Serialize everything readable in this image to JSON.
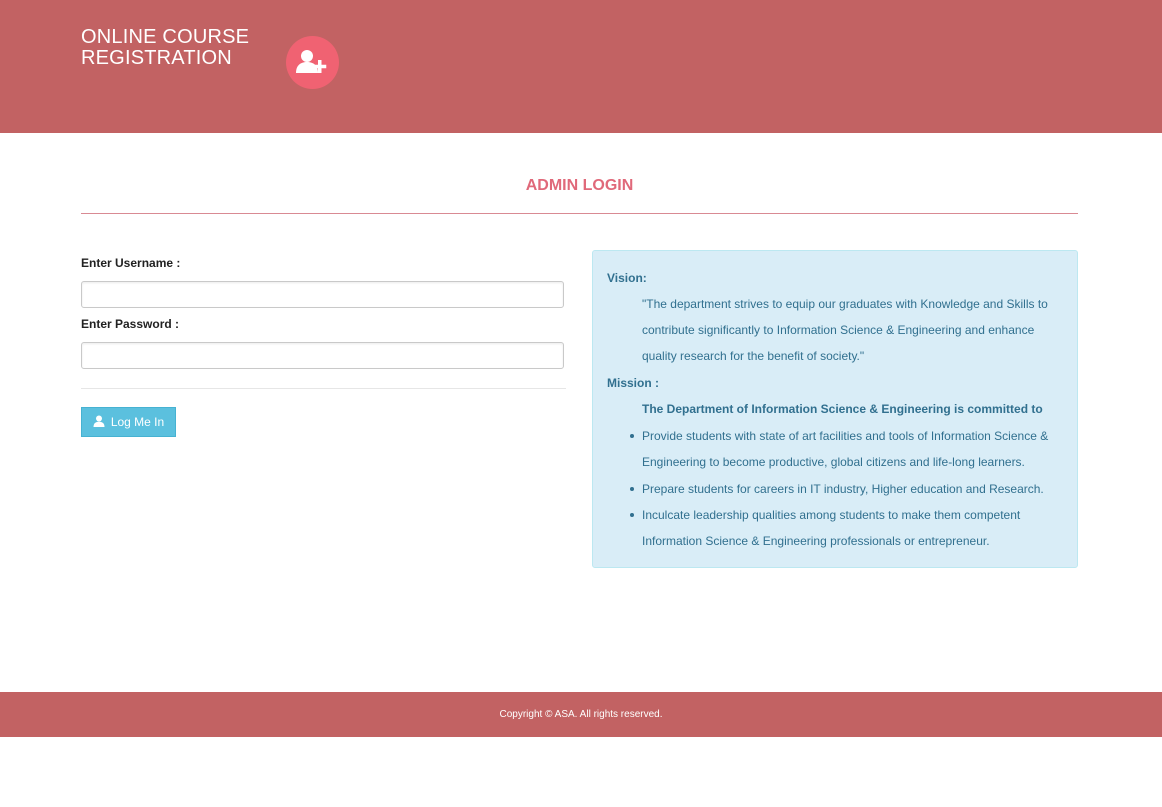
{
  "header": {
    "brand_line1": "ONLINE COURSE",
    "brand_line2": "REGISTRATION",
    "brand_icon": "user-plus-icon",
    "background_color": "#c26263",
    "icon_color": "#f06272"
  },
  "main": {
    "title": "ADMIN LOGIN",
    "title_color": "#e0697a"
  },
  "form": {
    "username_label": "Enter Username :",
    "username_value": "",
    "password_label": "Enter Password :",
    "password_value": "",
    "login_button_label": "Log Me In",
    "login_button_icon": "user-icon",
    "button_color": "#5bc0de"
  },
  "info": {
    "vision_heading": "Vision:",
    "vision_text": "\"The department strives to equip our graduates with Knowledge and Skills to contribute significantly to Information Science & Engineering and enhance quality research for the benefit of society.\"",
    "mission_heading": "Mission :",
    "mission_intro": "The Department of Information Science & Engineering is committed to",
    "mission_items": [
      "Provide students with state of art facilities and tools of Information Science & Engineering to become productive, global citizens and life-long learners.",
      "Prepare students for careers in IT industry, Higher education and Research.",
      "Inculcate leadership qualities among students to make them competent Information Science & Engineering professionals or entrepreneur."
    ],
    "background_color": "#d9edf7",
    "text_color": "#31708f"
  },
  "footer": {
    "copyright": "Copyright © ASA. All rights reserved."
  }
}
